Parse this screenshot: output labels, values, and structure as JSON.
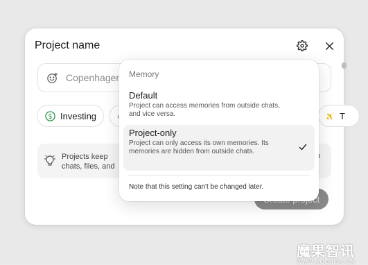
{
  "modal": {
    "title": "Project name",
    "name_input": {
      "value": "Copenhagen"
    },
    "chips": [
      {
        "label": "Investing",
        "icon": "dollar-icon"
      },
      {
        "label": "",
        "icon": "partial-icon"
      },
      {
        "label": "T",
        "icon": "airplane-icon"
      }
    ],
    "info": {
      "text": "Projects keep chats, files, and custom instructions in one place. Use them for ongoing work",
      "text_visible": "Projects keep ch for ongoing work",
      "tail": "n"
    },
    "create_button": "Create project"
  },
  "menu": {
    "header": "Memory",
    "options": [
      {
        "title": "Default",
        "desc": "Project can access memories from outside chats, and vice versa.",
        "selected": false
      },
      {
        "title": "Project-only",
        "desc": "Project can only access its own memories. Its memories are hidden from outside chats.",
        "selected": true
      }
    ],
    "note": "Note that this setting can't be changed later."
  },
  "watermark": {
    "big": "魔果智讯",
    "small": "WWW.MOGUOAI.CN"
  },
  "colors": {
    "button": "#8a8a8a",
    "selected_bg": "#f2f2f2",
    "accent_green": "#1e8e3e",
    "accent_yellow": "#e8b400"
  }
}
